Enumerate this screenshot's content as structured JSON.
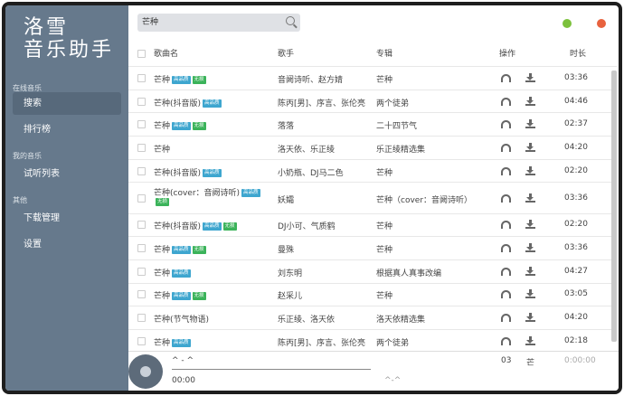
{
  "sidebar": {
    "logo_line1": "洛雪",
    "logo_line2": "音乐助手",
    "sections": [
      {
        "label": "在线音乐",
        "items": [
          "搜索",
          "排行榜"
        ]
      },
      {
        "label": "我的音乐",
        "items": [
          "试听列表"
        ]
      },
      {
        "label": "其他",
        "items": [
          "下载管理",
          "设置"
        ]
      }
    ]
  },
  "search": {
    "value": "芒种"
  },
  "table": {
    "headers": {
      "name": "歌曲名",
      "singer": "歌手",
      "album": "专辑",
      "ops": "操作",
      "duration": "时长"
    },
    "tags": {
      "hq": "高品质",
      "ad": "无损"
    },
    "rows": [
      {
        "name": "芒种",
        "hq": true,
        "ad": true,
        "singer": "音阙诗听、赵方婧",
        "album": "芒种",
        "duration": "03:36"
      },
      {
        "name": "芒种(抖音版)",
        "hq": true,
        "ad": false,
        "singer": "陈丙[男]、序言、张伦亮",
        "album": "两个徒弟",
        "duration": "04:46"
      },
      {
        "name": "芒种",
        "hq": true,
        "ad": true,
        "singer": "落落",
        "album": "二十四节气",
        "duration": "02:37"
      },
      {
        "name": "芒种",
        "hq": false,
        "ad": false,
        "singer": "洛天依、乐正绫",
        "album": "乐正绫精选集",
        "duration": "04:20"
      },
      {
        "name": "芒种(抖音版)",
        "hq": true,
        "ad": false,
        "singer": "小奶瓶、DJ马二色",
        "album": "芒种",
        "duration": "02:20"
      },
      {
        "name": "芒种(cover：音阙诗听)",
        "hq": true,
        "ad": true,
        "singer": "妖孀",
        "album": "芒种（cover：音阙诗听）",
        "duration": "03:36"
      },
      {
        "name": "芒种(抖音版)",
        "hq": true,
        "ad": true,
        "singer": "DJ小可、气质鹤",
        "album": "芒种",
        "duration": "02:20"
      },
      {
        "name": "芒种",
        "hq": true,
        "ad": true,
        "singer": "曼殊",
        "album": "芒种",
        "duration": "03:36"
      },
      {
        "name": "芒种",
        "hq": true,
        "ad": false,
        "singer": "刘东明",
        "album": "根据真人真事改编",
        "duration": "04:27"
      },
      {
        "name": "芒种",
        "hq": true,
        "ad": true,
        "singer": "赵采儿",
        "album": "芒种",
        "duration": "03:05"
      },
      {
        "name": "芒种(节气物语)",
        "hq": false,
        "ad": false,
        "singer": "乐正绫、洛天依",
        "album": "洛天依精选集",
        "duration": "04:20"
      },
      {
        "name": "芒种",
        "hq": true,
        "ad": false,
        "singer": "陈丙[男]、序言、张伦亮",
        "album": "两个徒弟",
        "duration": "02:18"
      }
    ]
  },
  "player": {
    "title": "^ - ^",
    "time": "00:00",
    "singer": "^-^",
    "extra1": "03",
    "extra2": "芒",
    "total": "0:00:00"
  },
  "colors": {
    "sidebar": "#66798c",
    "green": "#7cc13c",
    "red": "#e8623e"
  }
}
